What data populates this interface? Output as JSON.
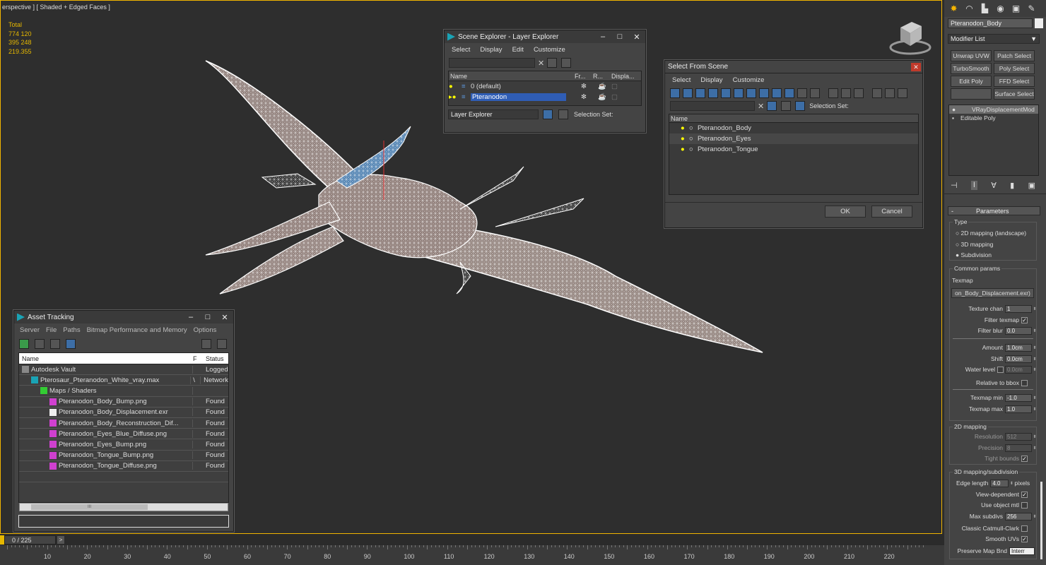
{
  "viewport": {
    "label": "erspective ] [ Shaded + Edged Faces ]",
    "stats": [
      "Total",
      "774 120",
      "395 248",
      "",
      "219.355"
    ]
  },
  "scene_explorer": {
    "title": "Scene Explorer - Layer Explorer",
    "menu": [
      "Select",
      "Display",
      "Edit",
      "Customize"
    ],
    "columns": [
      "Name",
      "Fr...",
      "R...",
      "Displa..."
    ],
    "rows": [
      "0 (default)",
      "Pteranodon"
    ],
    "footer_dropdown": "Layer Explorer",
    "selection_set": "Selection Set:"
  },
  "select_from_scene": {
    "title": "Select From Scene",
    "menu": [
      "Select",
      "Display",
      "Customize"
    ],
    "selection_set": "Selection Set:",
    "column": "Name",
    "rows": [
      "Pteranodon_Body",
      "Pteranodon_Eyes",
      "Pteranodon_Tongue"
    ],
    "ok": "OK",
    "cancel": "Cancel"
  },
  "asset_tracking": {
    "title": "Asset Tracking",
    "menu": [
      "Server",
      "File",
      "Paths",
      "Bitmap Performance and Memory",
      "Options"
    ],
    "columns": [
      "Name",
      "F",
      "Status"
    ],
    "rows": [
      {
        "name": "Autodesk Vault",
        "f": "",
        "status": "Logged",
        "indent": 0,
        "icon": "vault-icon"
      },
      {
        "name": "Pterosaur_Pteranodon_White_vray.max",
        "f": "\\",
        "status": "Network",
        "indent": 1,
        "icon": "max-file-icon"
      },
      {
        "name": "Maps / Shaders",
        "f": "",
        "status": "",
        "indent": 2,
        "icon": "maps-icon"
      },
      {
        "name": "Pteranodon_Body_Bump.png",
        "f": "",
        "status": "Found",
        "indent": 3,
        "icon": "png-icon"
      },
      {
        "name": "Pteranodon_Body_Displacement.exr",
        "f": "",
        "status": "Found",
        "indent": 3,
        "icon": "exr-icon"
      },
      {
        "name": "Pteranodon_Body_Reconstruction_Dif...",
        "f": "",
        "status": "Found",
        "indent": 3,
        "icon": "png-icon"
      },
      {
        "name": "Pteranodon_Eyes_Blue_Diffuse.png",
        "f": "",
        "status": "Found",
        "indent": 3,
        "icon": "png-icon"
      },
      {
        "name": "Pteranodon_Eyes_Bump.png",
        "f": "",
        "status": "Found",
        "indent": 3,
        "icon": "png-icon"
      },
      {
        "name": "Pteranodon_Tongue_Bump.png",
        "f": "",
        "status": "Found",
        "indent": 3,
        "icon": "png-icon"
      },
      {
        "name": "Pteranodon_Tongue_Diffuse.png",
        "f": "",
        "status": "Found",
        "indent": 3,
        "icon": "png-icon"
      }
    ],
    "scroll_thumb": "III"
  },
  "command_panel": {
    "object_name": "Pteranodon_Body",
    "modifier_list": "Modifier List",
    "modifier_buttons": [
      "Unwrap UVW",
      "Patch Select",
      "TurboSmooth",
      "Poly Select",
      "Edit Poly",
      "FFD Select",
      "",
      "Surface Select"
    ],
    "stack": [
      "VRayDisplacementMod",
      "Editable Poly"
    ],
    "rollout": "Parameters",
    "type_group": "Type",
    "type_options": [
      "2D mapping (landscape)",
      "3D mapping",
      "Subdivision"
    ],
    "common_group": "Common params",
    "texmap_label": "Texmap",
    "texmap_value": "on_Body_Displacement.exr)",
    "texture_chan": {
      "label": "Texture chan",
      "value": "1"
    },
    "filter_texmap": "Filter texmap",
    "filter_blur": {
      "label": "Filter blur",
      "value": "0.0"
    },
    "amount": {
      "label": "Amount",
      "value": "1.0cm"
    },
    "shift": {
      "label": "Shift",
      "value": "0.0cm"
    },
    "water_level": {
      "label": "Water level",
      "value": "0.0cm"
    },
    "relative_bbox": "Relative to bbox",
    "texmap_min": {
      "label": "Texmap min",
      "value": "-1.0"
    },
    "texmap_max": {
      "label": "Texmap max",
      "value": "1.0"
    },
    "mapping2d_group": "2D mapping",
    "resolution": {
      "label": "Resolution",
      "value": "512"
    },
    "precision": {
      "label": "Precision",
      "value": "8"
    },
    "tight_bounds": "Tight bounds",
    "mapping3d_group": "3D mapping/subdivision",
    "edge_length": {
      "label": "Edge length",
      "value": "4.0",
      "unit": "pixels"
    },
    "view_dependent": "View-dependent",
    "use_object_mtl": "Use object mtl",
    "max_subdivs": {
      "label": "Max subdivs",
      "value": "256"
    },
    "classic_cc": "Classic Catmull-Clark",
    "smooth_uvs": "Smooth UVs",
    "preserve_map": {
      "label": "Preserve Map Bnd",
      "value": "Interr"
    }
  },
  "timeline": {
    "slider": "0 / 225",
    "ticks": [
      "10",
      "20",
      "30",
      "40",
      "50",
      "60",
      "70",
      "80",
      "90",
      "100",
      "110",
      "120",
      "130",
      "140",
      "150",
      "160",
      "170",
      "180",
      "190",
      "200",
      "210",
      "220"
    ]
  }
}
